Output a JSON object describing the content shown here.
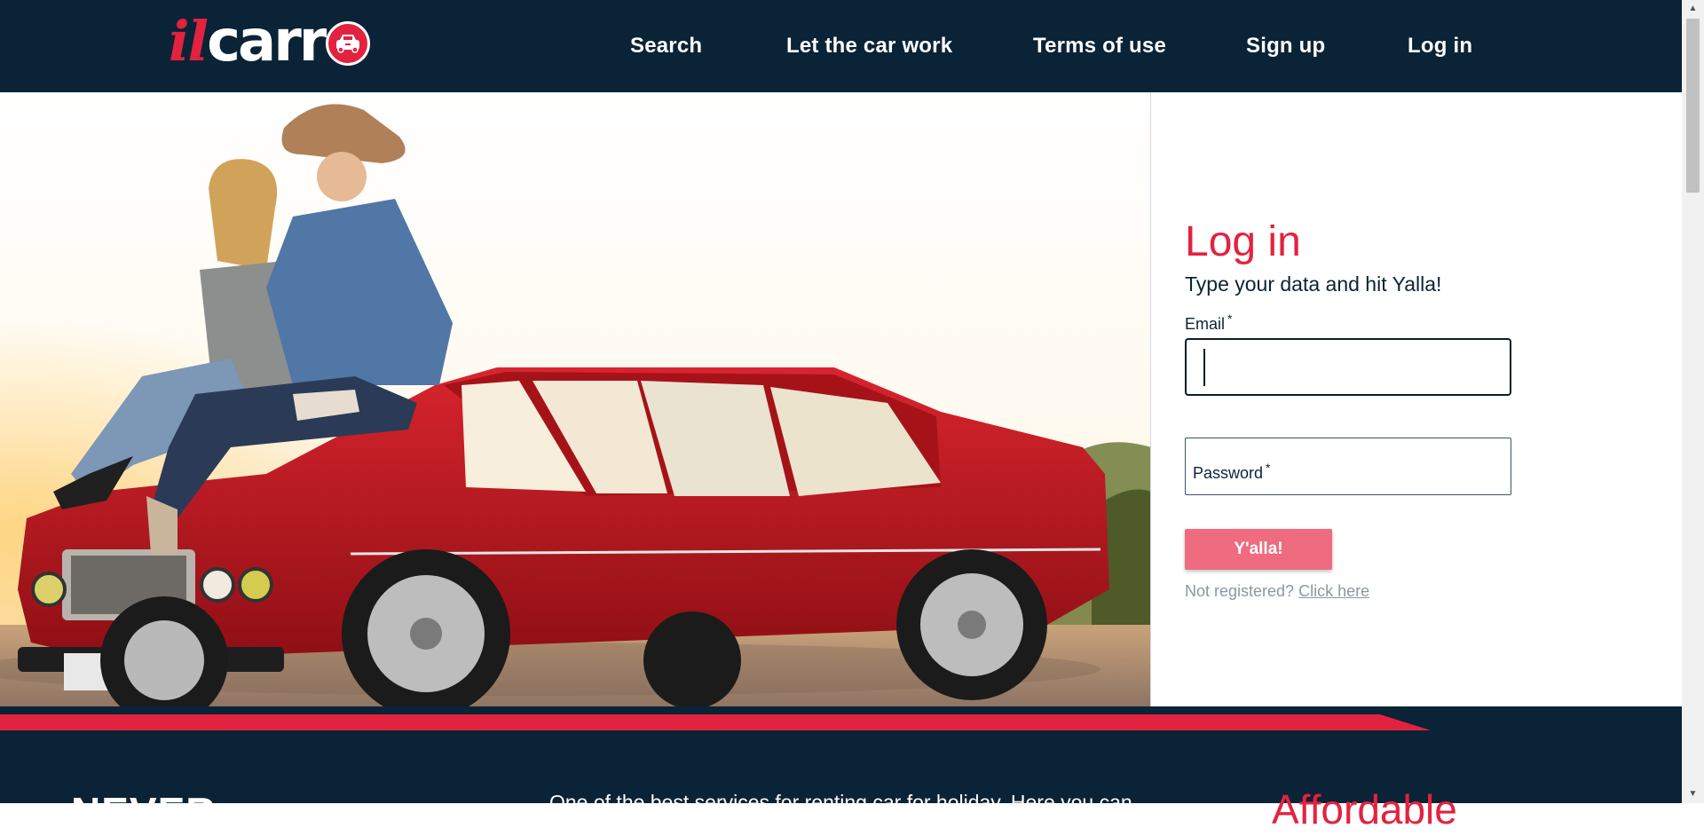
{
  "header": {
    "logo": {
      "il": "il",
      "carr": "carr"
    },
    "nav": [
      {
        "label": "Search"
      },
      {
        "label": "Let the car work"
      },
      {
        "label": "Terms of use"
      },
      {
        "label": "Sign up"
      },
      {
        "label": "Log in"
      }
    ]
  },
  "hero": {
    "image_alt": "couple-sitting-on-red-sedan"
  },
  "login": {
    "title": "Log in",
    "subtitle": "Type your data and hit Yalla!",
    "email_label": "Email",
    "email_required": "*",
    "email_value": "",
    "password_label": "Password",
    "password_required": "*",
    "password_value": "",
    "submit_label": "Y'alla!",
    "not_registered": "Not registered?",
    "click_here": "Click here"
  },
  "footer": {
    "big_text": "NEVER",
    "text": "One of the best services for renting car for holiday. Here you can",
    "red_text": "Affordable"
  },
  "colors": {
    "navy": "#0b2336",
    "brand_red": "#e3223f",
    "button_pink": "#ef6b7f",
    "muted_text": "#8a98a3"
  }
}
